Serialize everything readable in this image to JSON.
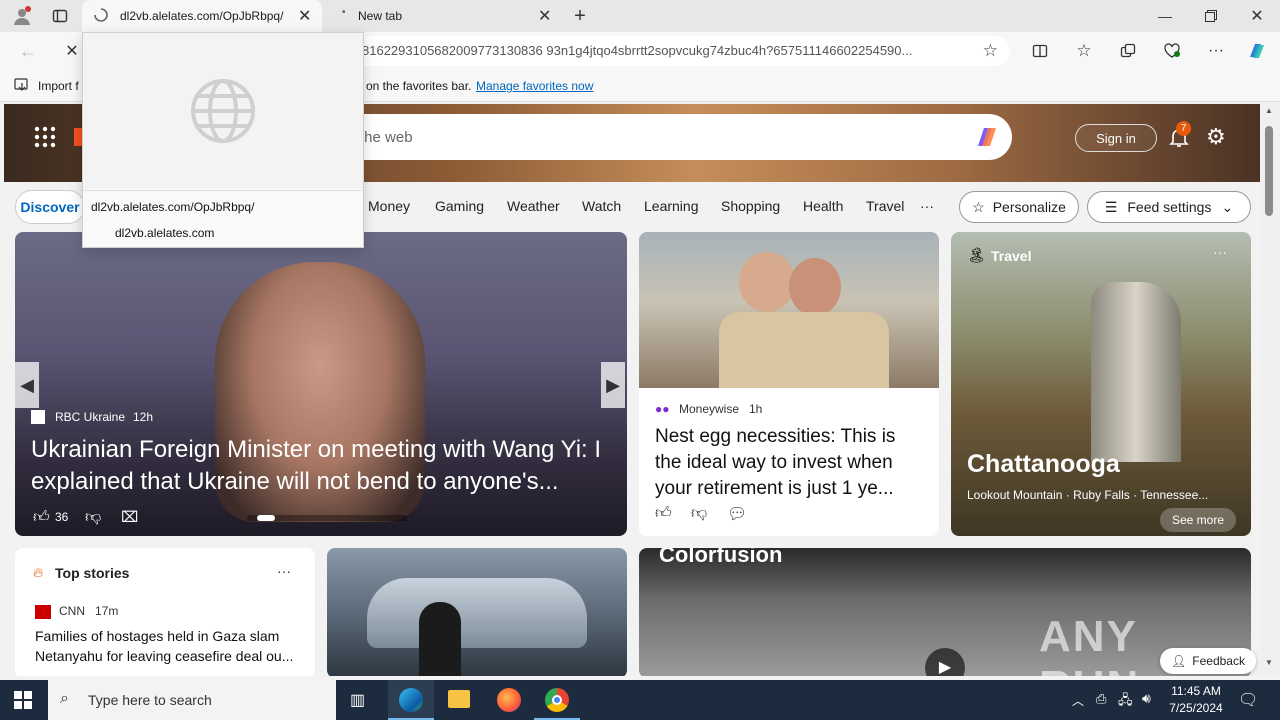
{
  "tabs": [
    {
      "title": "dl2vb.alelates.com/OpJbRbpq/",
      "loading": true
    },
    {
      "title": "New tab",
      "loading": false
    }
  ],
  "address": {
    "url": "8162293105682009773130836 93n1g4jtqo4sbrrtt2sopvcukg74zbuc4h?657511146602254590..."
  },
  "favbar": {
    "import_label": "Import f",
    "hint": "on the favorites bar.",
    "manage_link": "Manage favorites now"
  },
  "hover_popup": {
    "url": "dl2vb.alelates.com/OpJbRbpq/",
    "domain": "dl2vb.alelates.com"
  },
  "header": {
    "search_placeholder": "the web",
    "sign_in": "Sign in",
    "notification_count": "7"
  },
  "nav": {
    "discover": "Discover",
    "items": [
      "Money",
      "Gaming",
      "Weather",
      "Watch",
      "Learning",
      "Shopping",
      "Health",
      "Travel"
    ],
    "more": "···",
    "personalize": "Personalize",
    "feed_settings": "Feed settings"
  },
  "main_story": {
    "source": "RBC Ukraine",
    "age": "12h",
    "title": "Ukrainian Foreign Minister on meeting with Wang Yi: I explained that Ukraine will not bend to anyone's...",
    "likes": "36"
  },
  "story2": {
    "source": "Moneywise",
    "age": "1h",
    "title": "Nest egg necessities: This is the ideal way to invest when your retirement is just 1 ye..."
  },
  "travel": {
    "label": "Travel",
    "title": "Chattanooga",
    "subtitle": "Lookout Mountain · Ruby Falls · Tennessee...",
    "see_more": "See more"
  },
  "top_stories": {
    "label": "Top stories",
    "more": "···",
    "source": "CNN",
    "age": "17m",
    "title": "Families of hostages held in Gaza slam Netanyahu for leaving ceasefire deal ou..."
  },
  "video_card": {
    "caption": "Colorfusion"
  },
  "watermark": "ANY RUN",
  "feedback": "Feedback",
  "taskbar": {
    "search_placeholder": "Type here to search",
    "time": "11:45 AM",
    "date": "7/25/2024"
  },
  "colors": {
    "accent": "#0067c0",
    "taskbar": "#1c2b3d",
    "tab_strip": "#e7e7e7"
  }
}
